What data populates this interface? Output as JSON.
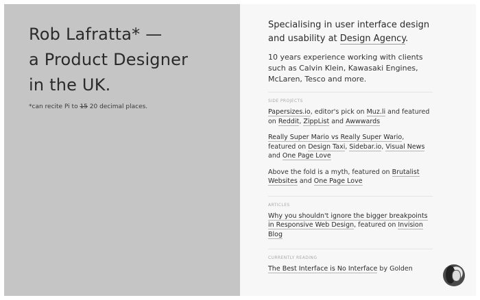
{
  "hero": {
    "line1": "Rob Lafratta* —",
    "line2": "a Product Designer",
    "line3": "in the UK.",
    "footnote_pre": "*can recite Pi to ",
    "footnote_strike": "15",
    "footnote_post": " 20 decimal places."
  },
  "intro": {
    "text_pre": "Specialising in user interface design and usability at ",
    "link": "Design Agency",
    "text_post": "."
  },
  "experience": "10 years experience working with clients such as Calvin Klein, Kawasaki Engines, McLaren, Tesco and more.",
  "side_projects": {
    "label": "SIDE PROJECTS",
    "items": [
      {
        "p1": "Papersizes.io",
        "t1": ", editor's pick on ",
        "p2": "Muz.li",
        "t2": " and featured on ",
        "p3": "Reddit",
        "t3": ", ",
        "p4": "ZippList",
        "t4": " and ",
        "p5": "Awwwards"
      },
      {
        "p1": "Really Super Mario vs Really Super Wario",
        "t1": ", featured on ",
        "p2": "Design Taxi",
        "t2": ", ",
        "p3": "Sidebar.io",
        "t3": ", ",
        "p4": "Visual News",
        "t4": " and ",
        "p5": "One Page Love"
      },
      {
        "t0": "Above the fold is a myth, featured on ",
        "p1": "Brutalist Websites",
        "t1": " and ",
        "p2": "One Page Love"
      }
    ]
  },
  "articles": {
    "label": "ARTICLES",
    "link": "Why you shouldn't ignore the bigger breakpoints in Responsive Web Design",
    "t1": ", featured on ",
    "source": "Invision Blog"
  },
  "reading": {
    "label": "CURRENTLY READING",
    "link": "The Best Interface is No Interface",
    "t1": " by Golden"
  },
  "avatar_icon": "profile-photo"
}
